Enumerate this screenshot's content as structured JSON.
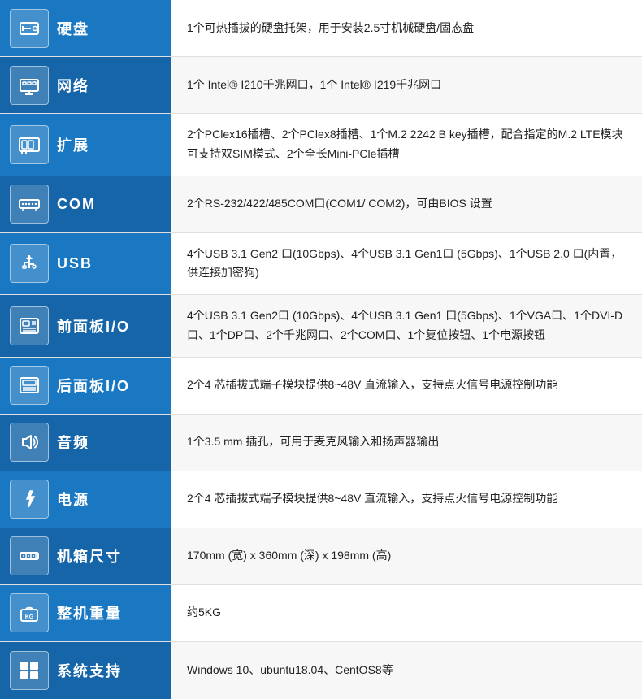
{
  "rows": [
    {
      "id": "harddisk",
      "label": "硬盘",
      "icon": "hdd",
      "icon_symbol": "💽",
      "content": "1个可热插拔的硬盘托架，用于安装2.5寸机械硬盘/固态盘"
    },
    {
      "id": "network",
      "label": "网络",
      "icon": "network",
      "icon_symbol": "🌐",
      "content": "1个 Intel® I210千兆网口，1个 Intel® I219千兆网口"
    },
    {
      "id": "expansion",
      "label": "扩展",
      "icon": "expansion",
      "icon_symbol": "🔌",
      "content": "2个PClex16插槽、2个PClex8插槽、1个M.2 2242 B key插槽，配合指定的M.2 LTE模块可支持双SIM模式、2个全长Mini-PCle插槽"
    },
    {
      "id": "com",
      "label": "COM",
      "icon": "com",
      "icon_symbol": "⬛",
      "content": "2个RS-232/422/485COM口(COM1/ COM2)，可由BIOS 设置"
    },
    {
      "id": "usb",
      "label": "USB",
      "icon": "usb",
      "icon_symbol": "⚡",
      "content": "4个USB 3.1 Gen2 口(10Gbps)、4个USB 3.1 Gen1口 (5Gbps)、1个USB 2.0 口(内置，供连接加密狗)"
    },
    {
      "id": "front-io",
      "label": "前面板I/O",
      "icon": "front-io",
      "icon_symbol": "🖥",
      "content": "4个USB 3.1 Gen2口 (10Gbps)、4个USB 3.1 Gen1 口(5Gbps)、1个VGA口、1个DVI-D口、1个DP口、2个千兆网口、2个COM口、1个复位按钮、1个电源按钮"
    },
    {
      "id": "rear-io",
      "label": "后面板I/O",
      "icon": "rear-io",
      "icon_symbol": "🖥",
      "content": "2个4 芯插拔式端子模块提供8~48V 直流输入，支持点火信号电源控制功能"
    },
    {
      "id": "audio",
      "label": "音频",
      "icon": "audio",
      "icon_symbol": "🔊",
      "content": "1个3.5 mm 插孔，可用于麦克风输入和扬声器输出"
    },
    {
      "id": "power",
      "label": "电源",
      "icon": "power",
      "icon_symbol": "⚡",
      "content": "2个4 芯插拔式端子模块提供8~48V 直流输入，支持点火信号电源控制功能"
    },
    {
      "id": "chassis-size",
      "label": "机箱尺寸",
      "icon": "ruler",
      "icon_symbol": "📐",
      "content": "170mm (宽) x 360mm (深) x 198mm (高)"
    },
    {
      "id": "weight",
      "label": "整机重量",
      "icon": "weight",
      "icon_symbol": "⚖",
      "content": "约5KG"
    },
    {
      "id": "os",
      "label": "系统支持",
      "icon": "os",
      "icon_symbol": "🪟",
      "content": "Windows 10、ubuntu18.04、CentOS8等"
    }
  ]
}
